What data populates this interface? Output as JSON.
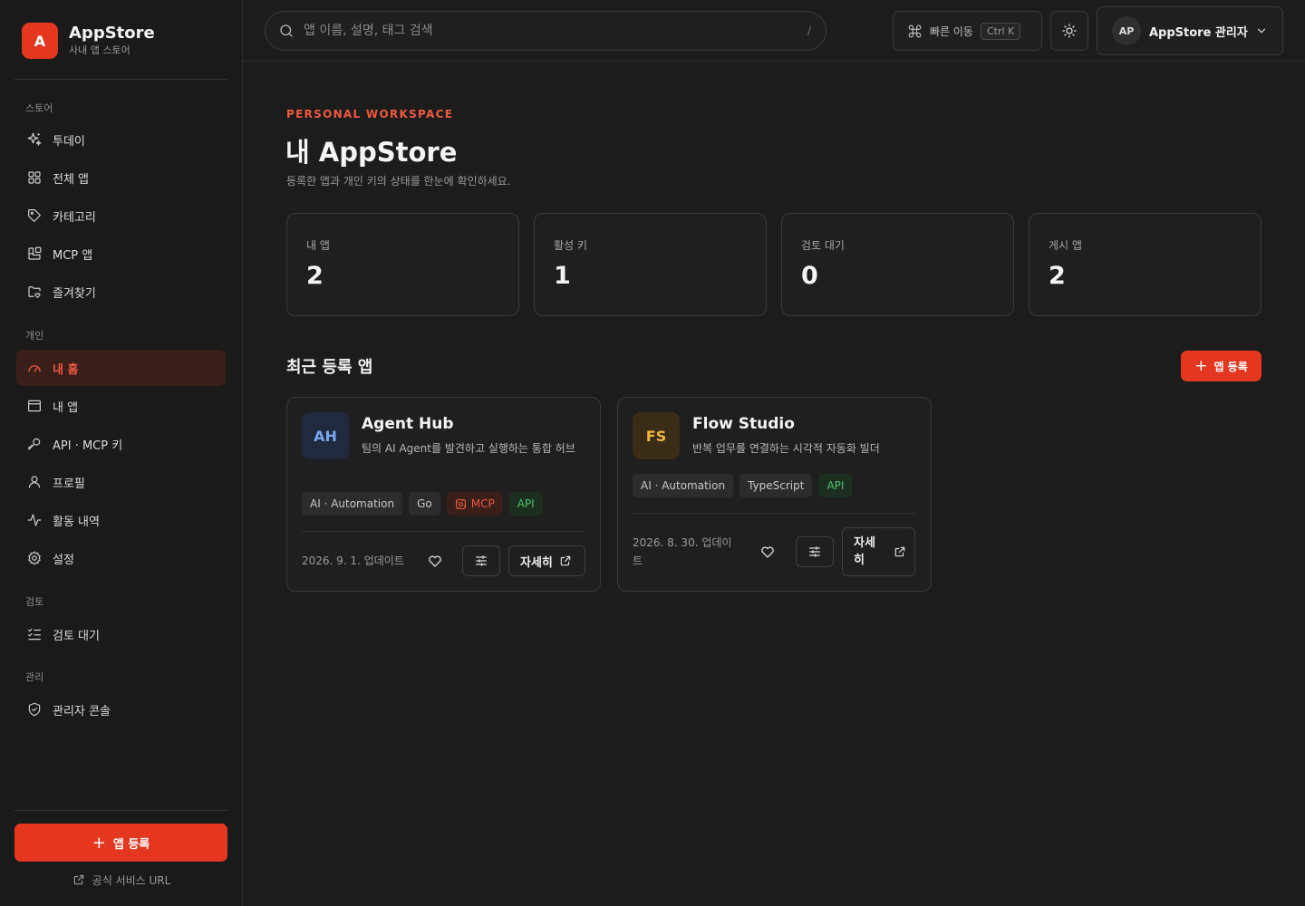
{
  "brand": {
    "logo_letter": "A",
    "name": "AppStore",
    "subtitle": "사내 앱 스토어",
    "accent": "#e5371f"
  },
  "sidebar": {
    "sections": [
      {
        "label": "스토어",
        "items": [
          {
            "label": "투데이",
            "icon": "sparkles-icon"
          },
          {
            "label": "전체 앱",
            "icon": "grid-icon"
          },
          {
            "label": "카테고리",
            "icon": "tag-icon"
          },
          {
            "label": "MCP 앱",
            "icon": "blocks-icon"
          },
          {
            "label": "즐겨찾기",
            "icon": "folder-heart-icon"
          }
        ]
      },
      {
        "label": "개인",
        "items": [
          {
            "label": "내 홈",
            "icon": "gauge-icon",
            "active": true
          },
          {
            "label": "내 앱",
            "icon": "window-icon"
          },
          {
            "label": "API · MCP 키",
            "icon": "key-icon"
          },
          {
            "label": "프로필",
            "icon": "user-icon"
          },
          {
            "label": "활동 내역",
            "icon": "activity-icon"
          },
          {
            "label": "설정",
            "icon": "gear-icon"
          }
        ]
      },
      {
        "label": "검토",
        "items": [
          {
            "label": "검토 대기",
            "icon": "list-checks-icon"
          }
        ]
      },
      {
        "label": "관리",
        "items": [
          {
            "label": "관리자 콘솔",
            "icon": "shield-icon"
          }
        ]
      }
    ],
    "cta_label": "앱 등록",
    "link_label": "공식 서비스 URL"
  },
  "topbar": {
    "search_placeholder": "앱 이름, 설명, 태그 검색",
    "search_shortcut": "/",
    "quick_nav_label": "빠른 이동",
    "quick_nav_shortcut": "Ctrl K",
    "account_initials": "AP",
    "account_name": "AppStore 관리자"
  },
  "main": {
    "eyebrow": "PERSONAL WORKSPACE",
    "title": "내 AppStore",
    "description": "등록한 앱과 개인 키의 상태를 한눈에 확인하세요.",
    "stats": [
      {
        "label": "내 앱",
        "value": "2"
      },
      {
        "label": "활성 키",
        "value": "1"
      },
      {
        "label": "검토 대기",
        "value": "0"
      },
      {
        "label": "게시 앱",
        "value": "2"
      }
    ],
    "recent_title": "최근 등록 앱",
    "add_label": "앱 등록",
    "apps": [
      {
        "initials": "AH",
        "name": "Agent Hub",
        "description": "팀의 AI Agent를 발견하고 실행하는 통합 허브",
        "icon_bg": "#1f2a3f",
        "icon_color": "#7aa6f0",
        "tags": [
          {
            "label": "AI · Automation",
            "kind": "default"
          },
          {
            "label": "Go",
            "kind": "default"
          },
          {
            "label": "MCP",
            "kind": "mcp"
          },
          {
            "label": "API",
            "kind": "api"
          }
        ],
        "updated": "2026. 9. 1. 업데이트",
        "detail_label": "자세히"
      },
      {
        "initials": "FS",
        "name": "Flow Studio",
        "description": "반복 업무를 연결하는 시각적 자동화 빌더",
        "icon_bg": "#3a2d17",
        "icon_color": "#f0b442",
        "tags": [
          {
            "label": "AI · Automation",
            "kind": "default"
          },
          {
            "label": "TypeScript",
            "kind": "default"
          },
          {
            "label": "API",
            "kind": "api"
          }
        ],
        "updated": "2026. 8. 30. 업데이트",
        "detail_label": "자세히"
      }
    ]
  }
}
